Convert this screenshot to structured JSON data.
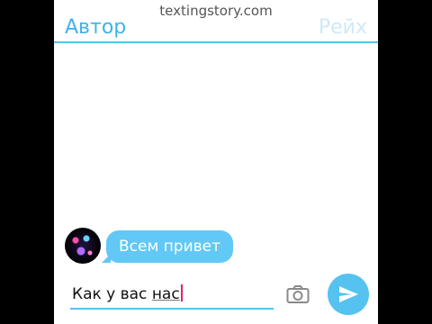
{
  "watermark": "textingstory.com",
  "header": {
    "left_name": "Автор",
    "right_name": "Рейх"
  },
  "messages": [
    {
      "text": "Всем привет",
      "side": "incoming"
    }
  ],
  "composer": {
    "text_before": "Как у вас ",
    "text_typing": "нас",
    "camera_icon": "camera-icon",
    "send_icon": "send-icon"
  },
  "colors": {
    "accent": "#55c2ef",
    "bubble": "#62c8f5",
    "caret": "#e0245e"
  }
}
